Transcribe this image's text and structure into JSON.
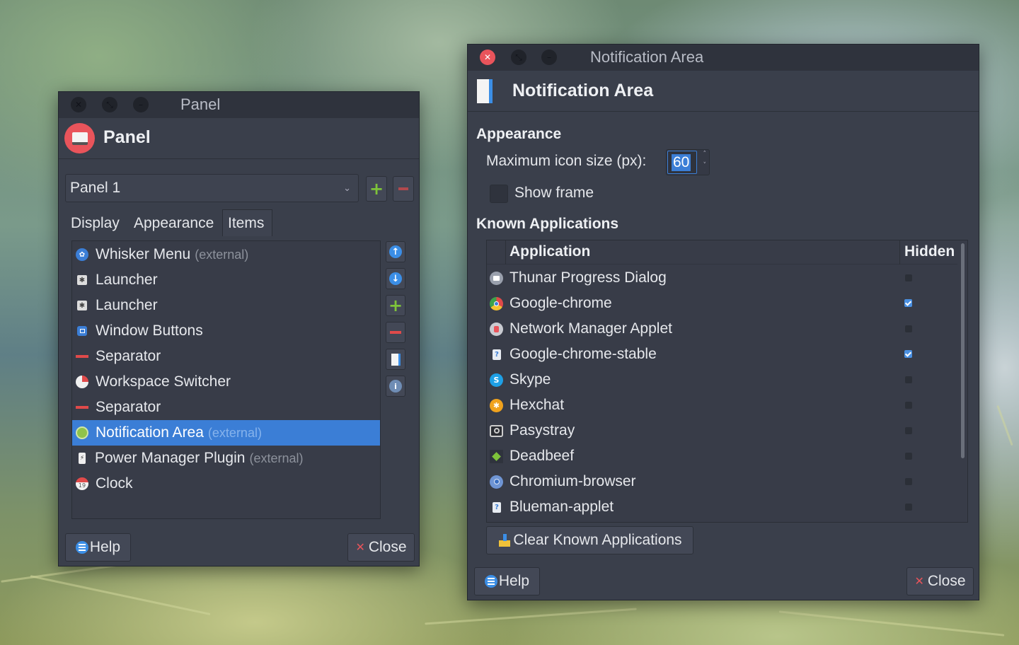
{
  "panel_window": {
    "title": "Panel",
    "header": "Panel",
    "panel_select": "Panel 1",
    "tabs": [
      "Display",
      "Appearance",
      "Items"
    ],
    "active_tab": "Items",
    "items": [
      {
        "name": "Whisker Menu",
        "suffix": "(external)",
        "icon": "whisker-menu-icon"
      },
      {
        "name": "Launcher",
        "suffix": "",
        "icon": "launcher-icon"
      },
      {
        "name": "Launcher",
        "suffix": "",
        "icon": "launcher-icon"
      },
      {
        "name": "Window Buttons",
        "suffix": "",
        "icon": "window-buttons-icon"
      },
      {
        "name": "Separator",
        "suffix": "",
        "icon": "separator-icon"
      },
      {
        "name": "Workspace Switcher",
        "suffix": "",
        "icon": "workspace-switcher-icon"
      },
      {
        "name": "Separator",
        "suffix": "",
        "icon": "separator-icon"
      },
      {
        "name": "Notification Area",
        "suffix": "(external)",
        "icon": "notification-area-icon",
        "selected": true
      },
      {
        "name": "Power Manager Plugin",
        "suffix": "(external)",
        "icon": "power-manager-icon"
      },
      {
        "name": "Clock",
        "suffix": "",
        "icon": "clock-icon"
      }
    ],
    "help_label": "Help",
    "close_label": "Close"
  },
  "notif_window": {
    "title": "Notification Area",
    "header": "Notification Area",
    "appearance_heading": "Appearance",
    "icon_size_label": "Maximum icon size (px):",
    "icon_size_value": "60",
    "show_frame_label": "Show frame",
    "known_apps_heading": "Known Applications",
    "col_application": "Application",
    "col_hidden": "Hidden",
    "apps": [
      {
        "name": "Thunar Progress Dialog",
        "hidden": false,
        "icon": "thunar-icon"
      },
      {
        "name": "Google-chrome",
        "hidden": true,
        "icon": "chrome-icon"
      },
      {
        "name": "Network Manager Applet",
        "hidden": false,
        "icon": "network-manager-icon"
      },
      {
        "name": "Google-chrome-stable",
        "hidden": true,
        "icon": "unknown-app-icon"
      },
      {
        "name": "Skype",
        "hidden": false,
        "icon": "skype-icon"
      },
      {
        "name": "Hexchat",
        "hidden": false,
        "icon": "hexchat-icon"
      },
      {
        "name": "Pasystray",
        "hidden": false,
        "icon": "pasystray-icon"
      },
      {
        "name": "Deadbeef",
        "hidden": false,
        "icon": "deadbeef-icon"
      },
      {
        "name": "Chromium-browser",
        "hidden": false,
        "icon": "chromium-icon"
      },
      {
        "name": "Blueman-applet",
        "hidden": false,
        "icon": "unknown-app-icon"
      }
    ],
    "clear_label": "Clear Known Applications",
    "help_label": "Help",
    "close_label": "Close"
  },
  "colors": {
    "accent": "#3b7ed6",
    "close_red": "#e9545b",
    "add_green": "#7ec33a",
    "remove_red": "#e04a4a"
  }
}
